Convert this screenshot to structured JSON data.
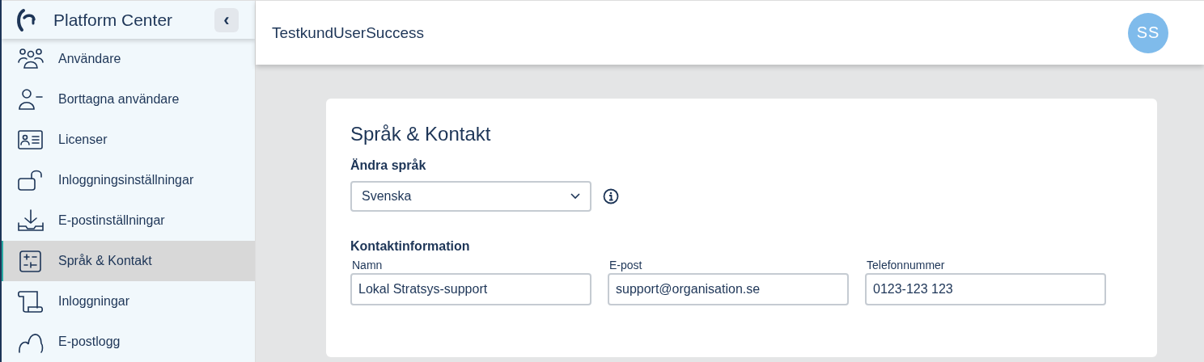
{
  "sidebar": {
    "brand": "Platform Center",
    "collapse_icon": "‹",
    "items": [
      {
        "label": "Användare",
        "kind": "users",
        "selected": false
      },
      {
        "label": "Borttagna användare",
        "kind": "user-minus",
        "selected": false
      },
      {
        "label": "Licenser",
        "kind": "id-card",
        "selected": false
      },
      {
        "label": "Inloggningsinställningar",
        "kind": "unlock",
        "selected": false
      },
      {
        "label": "E-postinställningar",
        "kind": "download",
        "selected": false
      },
      {
        "label": "Språk & Kontakt",
        "kind": "sliders",
        "selected": true
      },
      {
        "label": "Inloggningar",
        "kind": "scroll",
        "selected": false
      },
      {
        "label": "E-postlogg",
        "kind": "cloud",
        "selected": false
      }
    ]
  },
  "header": {
    "title": "TestkundUserSuccess",
    "avatar": "SS"
  },
  "card": {
    "title": "Språk & Kontakt",
    "language_label": "Ändra språk",
    "language_value": "Svenska",
    "contact_label": "Kontaktinformation",
    "fields": [
      {
        "label": "Namn",
        "value": "Lokal Stratsys-support"
      },
      {
        "label": "E-post",
        "value": "support@organisation.se"
      },
      {
        "label": "Telefonnummer",
        "value": "0123-123 123"
      }
    ]
  }
}
